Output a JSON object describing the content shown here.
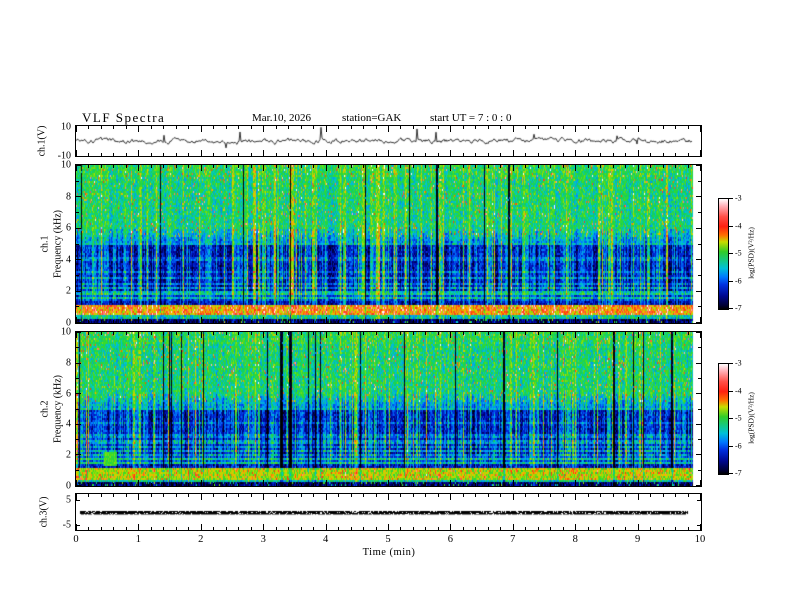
{
  "header": {
    "title": "VLF Spectra",
    "date": "Mar.10, 2026",
    "station": "station=GAK",
    "start_ut": "start UT =  7 : 0  : 0"
  },
  "xaxis": {
    "label": "Time  (min)",
    "ticks": [
      "0",
      "1",
      "2",
      "3",
      "4",
      "5",
      "6",
      "7",
      "8",
      "9",
      "10"
    ]
  },
  "panels": {
    "ch1_wave": {
      "ylabel": "ch.1(V)",
      "ytop": "10",
      "ybottom": "-10"
    },
    "spec1": {
      "channel": "ch.1",
      "ylabel": "Frequency  (kHz)",
      "yticks": [
        "10",
        "8",
        "6",
        "4",
        "2",
        "0"
      ]
    },
    "spec2": {
      "channel": "ch.2",
      "ylabel": "Frequency  (kHz)",
      "yticks": [
        "10",
        "8",
        "6",
        "4",
        "2",
        "0"
      ]
    },
    "ch3_wave": {
      "ylabel": "ch.3(V)",
      "ytop": "5",
      "ybottom": "-5"
    }
  },
  "colorbar": {
    "label": "log(PSD)(V²/Hz)",
    "ticks": [
      "-3",
      "-4",
      "-5",
      "-6",
      "-7"
    ]
  },
  "chart_data": [
    {
      "type": "line",
      "title": "ch.1 voltage waveform",
      "xlabel": "Time (min)",
      "xlim": [
        0,
        10
      ],
      "ylabel": "ch.1(V)",
      "ylim": [
        -10,
        10
      ],
      "description": "Noisy broadband waveform fluctuating around 0 V (~±2 V) with occasional impulsive spikes reaching toward ±10 V; data ends near 9.85 min."
    },
    {
      "type": "heatmap",
      "title": "ch.1 VLF spectrogram",
      "xlabel": "Time (min)",
      "xlim": [
        0,
        10
      ],
      "ylabel": "Frequency (kHz)",
      "ylim": [
        0,
        10
      ],
      "zlabel": "log(PSD)(V²/Hz)",
      "zlim": [
        -7,
        -3
      ],
      "features": [
        "green/yellow high PSD (~-4.5) above 6 kHz with red speckles",
        "dark blue/black low PSD (~-6.5) between 2 and 5 kHz",
        "dense vertical impulsive sferic stripes spanning 0-10 kHz",
        "occasional black dropout columns",
        "bright orange/red horizontal band (~-3.5) near 0.5-1.1 kHz",
        "narrow cyan horizontal harmonic lines between ~1.5 and 3 kHz",
        "dark bottom row below ~0.3 kHz"
      ]
    },
    {
      "type": "heatmap",
      "title": "ch.2 VLF spectrogram",
      "xlabel": "Time (min)",
      "xlim": [
        0,
        10
      ],
      "ylabel": "Frequency (kHz)",
      "ylim": [
        0,
        10
      ],
      "zlabel": "log(PSD)(V²/Hz)",
      "zlim": [
        -7,
        -3
      ],
      "features": [
        "same structure as ch.1: green above 6 kHz, dark blue 2-5 kHz",
        "vertical sferic stripes full height",
        "yellow-green speckled band near 0.5-1.1 kHz",
        "cyan harmonic lines 1.5-3 kHz",
        "bright green patch near 0.5 min at ~1.5-2 kHz"
      ]
    },
    {
      "type": "line",
      "title": "ch.3 voltage waveform",
      "xlabel": "Time (min)",
      "xlim": [
        0,
        10
      ],
      "ylabel": "ch.3(V)",
      "ylim": [
        -5,
        5
      ],
      "description": "Constant thick black trace at 0 V from 0 to ~9.8 min (no signal)."
    }
  ]
}
